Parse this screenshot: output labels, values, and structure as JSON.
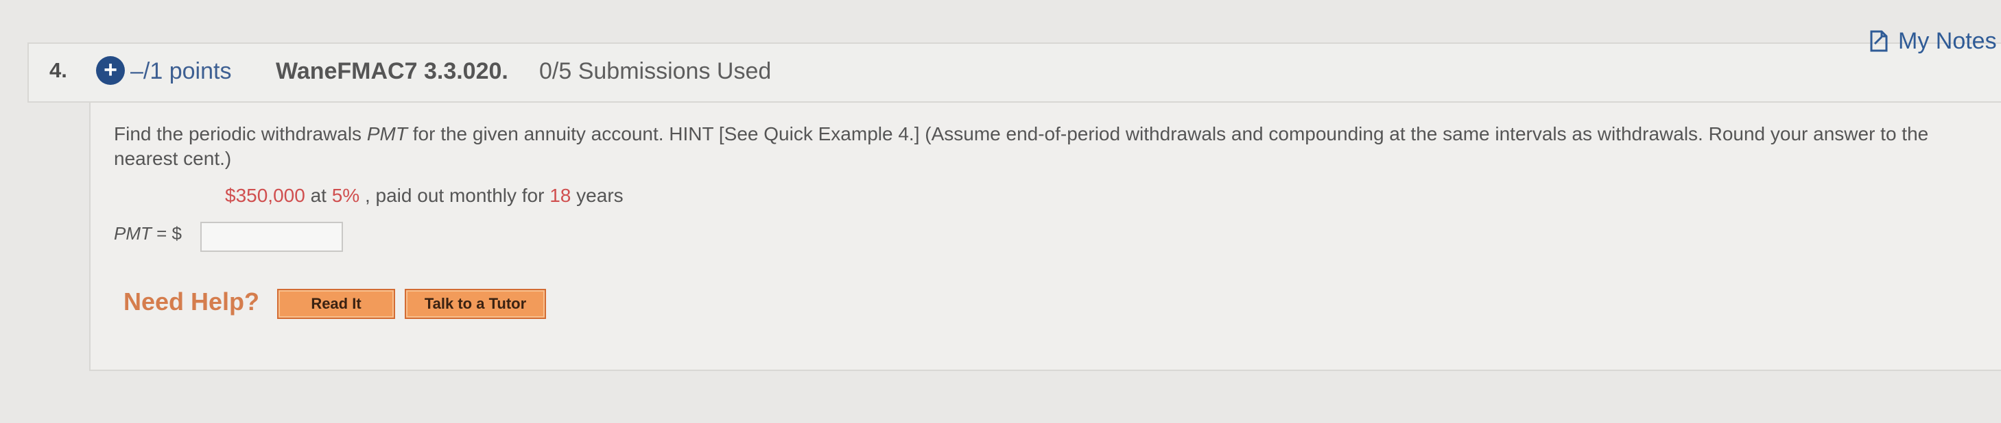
{
  "question": {
    "number": "4.",
    "points": "–/1 points",
    "assignment": "WaneFMAC7 3.3.020.",
    "submissions": "0/5 Submissions Used",
    "my_notes": "My Notes"
  },
  "prompt": {
    "text_before_pmt": "Find the periodic withdrawals ",
    "pmt_term": "PMT",
    "text_after_pmt": " for the given annuity account. HINT [See Quick Example 4.] (Assume end-of-period withdrawals and compounding at the same intervals as withdrawals. Round your answer to the nearest cent.)"
  },
  "given": {
    "amount": "$350,000",
    "at_text": " at ",
    "rate": "5%",
    "paid_text": ", paid out monthly for ",
    "years": "18",
    "years_text": " years"
  },
  "answer": {
    "label": "PMT",
    "equals": " = $",
    "value": ""
  },
  "help": {
    "label": "Need Help?",
    "read_it": "Read It",
    "talk_to_tutor": "Talk to a Tutor"
  },
  "colors": {
    "accent_blue": "#244c86",
    "help_orange": "#f29b5a",
    "highlight_red": "#d04f4f"
  }
}
